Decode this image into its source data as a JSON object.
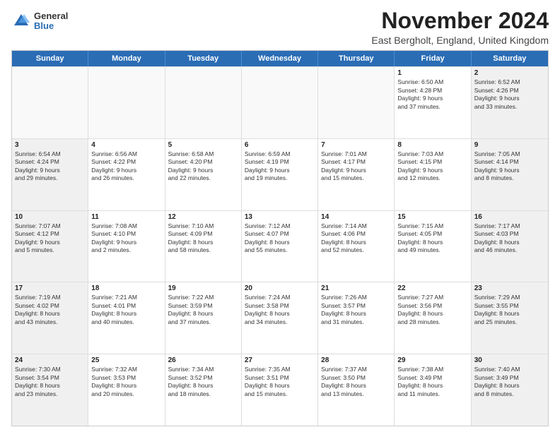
{
  "logo": {
    "general": "General",
    "blue": "Blue"
  },
  "title": "November 2024",
  "location": "East Bergholt, England, United Kingdom",
  "header_days": [
    "Sunday",
    "Monday",
    "Tuesday",
    "Wednesday",
    "Thursday",
    "Friday",
    "Saturday"
  ],
  "weeks": [
    [
      {
        "day": "",
        "text": "",
        "empty": true
      },
      {
        "day": "",
        "text": "",
        "empty": true
      },
      {
        "day": "",
        "text": "",
        "empty": true
      },
      {
        "day": "",
        "text": "",
        "empty": true
      },
      {
        "day": "",
        "text": "",
        "empty": true
      },
      {
        "day": "1",
        "text": "Sunrise: 6:50 AM\nSunset: 4:28 PM\nDaylight: 9 hours\nand 37 minutes.",
        "empty": false
      },
      {
        "day": "2",
        "text": "Sunrise: 6:52 AM\nSunset: 4:26 PM\nDaylight: 9 hours\nand 33 minutes.",
        "empty": false
      }
    ],
    [
      {
        "day": "3",
        "text": "Sunrise: 6:54 AM\nSunset: 4:24 PM\nDaylight: 9 hours\nand 29 minutes.",
        "empty": false
      },
      {
        "day": "4",
        "text": "Sunrise: 6:56 AM\nSunset: 4:22 PM\nDaylight: 9 hours\nand 26 minutes.",
        "empty": false
      },
      {
        "day": "5",
        "text": "Sunrise: 6:58 AM\nSunset: 4:20 PM\nDaylight: 9 hours\nand 22 minutes.",
        "empty": false
      },
      {
        "day": "6",
        "text": "Sunrise: 6:59 AM\nSunset: 4:19 PM\nDaylight: 9 hours\nand 19 minutes.",
        "empty": false
      },
      {
        "day": "7",
        "text": "Sunrise: 7:01 AM\nSunset: 4:17 PM\nDaylight: 9 hours\nand 15 minutes.",
        "empty": false
      },
      {
        "day": "8",
        "text": "Sunrise: 7:03 AM\nSunset: 4:15 PM\nDaylight: 9 hours\nand 12 minutes.",
        "empty": false
      },
      {
        "day": "9",
        "text": "Sunrise: 7:05 AM\nSunset: 4:14 PM\nDaylight: 9 hours\nand 8 minutes.",
        "empty": false
      }
    ],
    [
      {
        "day": "10",
        "text": "Sunrise: 7:07 AM\nSunset: 4:12 PM\nDaylight: 9 hours\nand 5 minutes.",
        "empty": false
      },
      {
        "day": "11",
        "text": "Sunrise: 7:08 AM\nSunset: 4:10 PM\nDaylight: 9 hours\nand 2 minutes.",
        "empty": false
      },
      {
        "day": "12",
        "text": "Sunrise: 7:10 AM\nSunset: 4:09 PM\nDaylight: 8 hours\nand 58 minutes.",
        "empty": false
      },
      {
        "day": "13",
        "text": "Sunrise: 7:12 AM\nSunset: 4:07 PM\nDaylight: 8 hours\nand 55 minutes.",
        "empty": false
      },
      {
        "day": "14",
        "text": "Sunrise: 7:14 AM\nSunset: 4:06 PM\nDaylight: 8 hours\nand 52 minutes.",
        "empty": false
      },
      {
        "day": "15",
        "text": "Sunrise: 7:15 AM\nSunset: 4:05 PM\nDaylight: 8 hours\nand 49 minutes.",
        "empty": false
      },
      {
        "day": "16",
        "text": "Sunrise: 7:17 AM\nSunset: 4:03 PM\nDaylight: 8 hours\nand 46 minutes.",
        "empty": false
      }
    ],
    [
      {
        "day": "17",
        "text": "Sunrise: 7:19 AM\nSunset: 4:02 PM\nDaylight: 8 hours\nand 43 minutes.",
        "empty": false
      },
      {
        "day": "18",
        "text": "Sunrise: 7:21 AM\nSunset: 4:01 PM\nDaylight: 8 hours\nand 40 minutes.",
        "empty": false
      },
      {
        "day": "19",
        "text": "Sunrise: 7:22 AM\nSunset: 3:59 PM\nDaylight: 8 hours\nand 37 minutes.",
        "empty": false
      },
      {
        "day": "20",
        "text": "Sunrise: 7:24 AM\nSunset: 3:58 PM\nDaylight: 8 hours\nand 34 minutes.",
        "empty": false
      },
      {
        "day": "21",
        "text": "Sunrise: 7:26 AM\nSunset: 3:57 PM\nDaylight: 8 hours\nand 31 minutes.",
        "empty": false
      },
      {
        "day": "22",
        "text": "Sunrise: 7:27 AM\nSunset: 3:56 PM\nDaylight: 8 hours\nand 28 minutes.",
        "empty": false
      },
      {
        "day": "23",
        "text": "Sunrise: 7:29 AM\nSunset: 3:55 PM\nDaylight: 8 hours\nand 25 minutes.",
        "empty": false
      }
    ],
    [
      {
        "day": "24",
        "text": "Sunrise: 7:30 AM\nSunset: 3:54 PM\nDaylight: 8 hours\nand 23 minutes.",
        "empty": false
      },
      {
        "day": "25",
        "text": "Sunrise: 7:32 AM\nSunset: 3:53 PM\nDaylight: 8 hours\nand 20 minutes.",
        "empty": false
      },
      {
        "day": "26",
        "text": "Sunrise: 7:34 AM\nSunset: 3:52 PM\nDaylight: 8 hours\nand 18 minutes.",
        "empty": false
      },
      {
        "day": "27",
        "text": "Sunrise: 7:35 AM\nSunset: 3:51 PM\nDaylight: 8 hours\nand 15 minutes.",
        "empty": false
      },
      {
        "day": "28",
        "text": "Sunrise: 7:37 AM\nSunset: 3:50 PM\nDaylight: 8 hours\nand 13 minutes.",
        "empty": false
      },
      {
        "day": "29",
        "text": "Sunrise: 7:38 AM\nSunset: 3:49 PM\nDaylight: 8 hours\nand 11 minutes.",
        "empty": false
      },
      {
        "day": "30",
        "text": "Sunrise: 7:40 AM\nSunset: 3:49 PM\nDaylight: 8 hours\nand 8 minutes.",
        "empty": false
      }
    ]
  ]
}
